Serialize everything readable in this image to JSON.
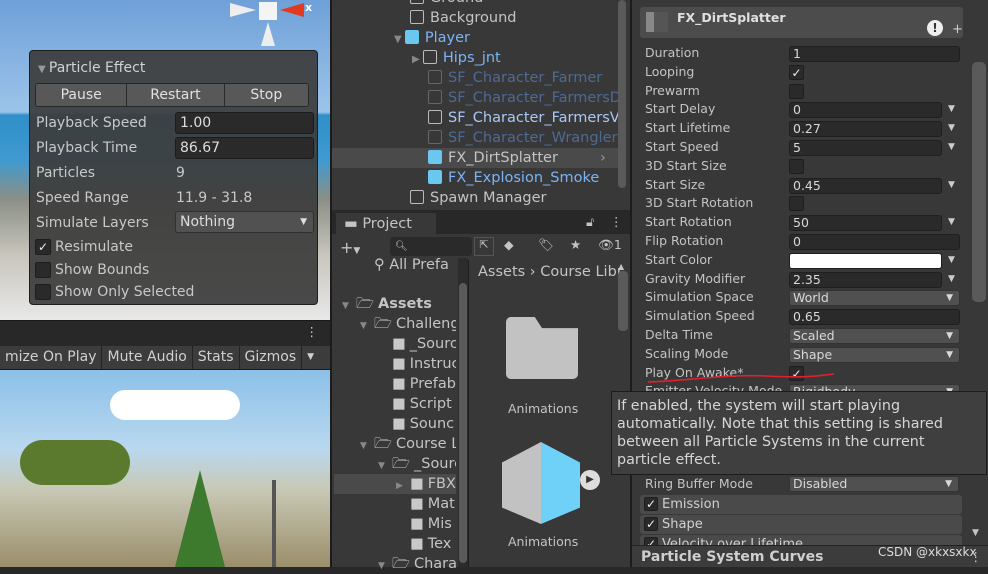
{
  "scene": {
    "gizmo_axis": "x",
    "particle_effect": {
      "title": "Particle Effect",
      "buttons": [
        "Pause",
        "Restart",
        "Stop"
      ],
      "playback_speed_label": "Playback Speed",
      "playback_speed": "1.00",
      "playback_time_label": "Playback Time",
      "playback_time": "86.67",
      "particles_label": "Particles",
      "particles": "9",
      "speed_range_label": "Speed Range",
      "speed_range": "11.9 - 31.8",
      "simulate_layers_label": "Simulate Layers",
      "simulate_layers": "Nothing",
      "resimulate": "Resimulate",
      "resimulate_checked": true,
      "show_bounds": "Show Bounds",
      "show_bounds_checked": false,
      "show_only_selected": "Show Only Selected",
      "show_only_selected_checked": false
    }
  },
  "game": {
    "toolbar": [
      "mize On Play",
      "Mute Audio",
      "Stats",
      "Gizmos"
    ]
  },
  "hierarchy": {
    "items": [
      {
        "label": "Ground",
        "color": "#c4c4c4"
      },
      {
        "label": "Background",
        "color": "#c4c4c4"
      },
      {
        "label": "Player",
        "color": "#7bb4f5"
      },
      {
        "label": "Hips_jnt",
        "color": "#7bb4f5"
      },
      {
        "label": "SF_Character_Farmer",
        "color": "#4e6a93"
      },
      {
        "label": "SF_Character_FarmersD",
        "color": "#4e6a93"
      },
      {
        "label": "SF_Character_FarmersV",
        "color": "#a9c9f5"
      },
      {
        "label": "SF_Character_Wrangler",
        "color": "#4e6a93"
      },
      {
        "label": "FX_DirtSplatter",
        "color": "#c4c4c4"
      },
      {
        "label": "FX_Explosion_Smoke",
        "color": "#7bb4f5"
      },
      {
        "label": "Spawn Manager",
        "color": "#c4c4c4"
      }
    ]
  },
  "project": {
    "tab": "Project",
    "hidden_count": "1",
    "all_prefabs": "All Prefa",
    "breadcrumb": [
      "Assets",
      "Course Libr"
    ],
    "tree": [
      {
        "label": "Assets",
        "bold": true
      },
      {
        "label": "Challeng"
      },
      {
        "label": "_Sourc"
      },
      {
        "label": "Instruc"
      },
      {
        "label": "Prefab"
      },
      {
        "label": "Script"
      },
      {
        "label": "Sounc"
      },
      {
        "label": "Course L"
      },
      {
        "label": "_Sourc"
      },
      {
        "label": "FBX"
      },
      {
        "label": "Mat"
      },
      {
        "label": "Mis"
      },
      {
        "label": "Tex"
      },
      {
        "label": "Chara"
      }
    ],
    "grid": [
      {
        "label": "Animations",
        "icon": "folder-icon"
      },
      {
        "label": "Animations",
        "icon": "prefab-icon"
      }
    ]
  },
  "inspector": {
    "title": "FX_DirtSplatter",
    "rows": [
      {
        "label": "Duration",
        "value": "1",
        "type": "field"
      },
      {
        "label": "Looping",
        "checked": true,
        "type": "check"
      },
      {
        "label": "Prewarm",
        "checked": false,
        "type": "check"
      },
      {
        "label": "Start Delay",
        "value": "0",
        "type": "curve"
      },
      {
        "label": "Start Lifetime",
        "value": "0.27",
        "type": "curve"
      },
      {
        "label": "Start Speed",
        "value": "5",
        "type": "curve"
      },
      {
        "label": "3D Start Size",
        "checked": false,
        "type": "check"
      },
      {
        "label": "Start Size",
        "value": "0.45",
        "type": "curve"
      },
      {
        "label": "3D Start Rotation",
        "checked": false,
        "type": "check"
      },
      {
        "label": "Start Rotation",
        "value": "50",
        "type": "curve"
      },
      {
        "label": "Flip Rotation",
        "value": "0",
        "type": "field"
      },
      {
        "label": "Start Color",
        "value": "",
        "type": "color"
      },
      {
        "label": "Gravity Modifier",
        "value": "2.35",
        "type": "curve"
      },
      {
        "label": "Simulation Space",
        "value": "World",
        "type": "dropdown"
      },
      {
        "label": "Simulation Speed",
        "value": "0.65",
        "type": "field"
      },
      {
        "label": "Delta Time",
        "value": "Scaled",
        "type": "dropdown"
      },
      {
        "label": "Scaling Mode",
        "value": "Shape",
        "type": "dropdown"
      },
      {
        "label": "Play On Awake*",
        "checked": true,
        "type": "check"
      },
      {
        "label": "Emitter Velocity Mode",
        "value": "Rigidbody",
        "type": "dropdown"
      }
    ],
    "ring_buffer_label": "Ring Buffer Mode",
    "ring_buffer": "Disabled",
    "modules": [
      {
        "label": "Emission",
        "checked": true
      },
      {
        "label": "Shape",
        "checked": true
      },
      {
        "label": "Velocity over Lifetime",
        "checked": true
      }
    ],
    "curves_title": "Particle System Curves",
    "tooltip": "If enabled, the system will start playing automatically. Note that this setting is shared between all Particle Systems in the current particle effect.",
    "annotation_color": "#e0202a"
  },
  "watermark": "CSDN @xkxsxkx"
}
